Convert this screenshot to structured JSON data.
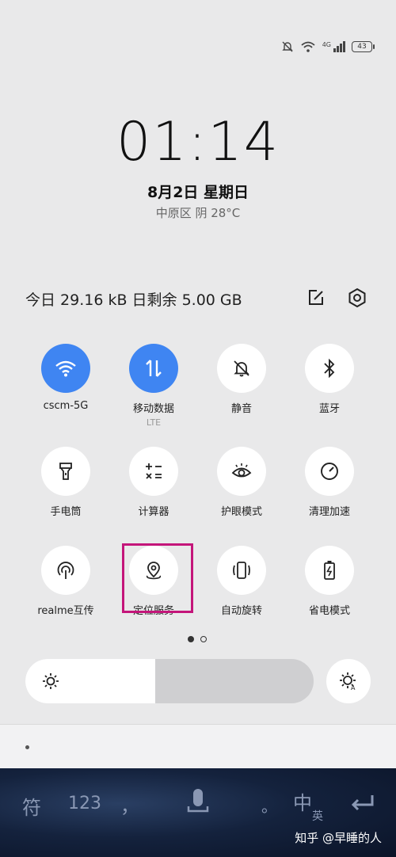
{
  "status_bar": {
    "icons": [
      "mute-bell-icon",
      "wifi-icon",
      "signal-4g-icon",
      "battery-icon"
    ],
    "network_label": "4G",
    "battery_level": "43"
  },
  "lockscreen": {
    "time": "01:14",
    "date": "8月2日  星期日",
    "weather": "中原区 阴 28°C"
  },
  "header": {
    "data_usage": "今日 29.16 kB  日剩余 5.00 GB",
    "edit_icon": "edit-icon",
    "settings_icon": "settings-icon"
  },
  "tiles": [
    {
      "label": "cscm-5G",
      "icon": "wifi-icon",
      "active": true
    },
    {
      "label": "移动数据",
      "sub": "LTE",
      "icon": "mobile-data-icon",
      "active": true
    },
    {
      "label": "静音",
      "icon": "mute-icon",
      "active": false
    },
    {
      "label": "蓝牙",
      "icon": "bluetooth-icon",
      "active": false
    },
    {
      "label": "手电筒",
      "icon": "flashlight-icon",
      "active": false
    },
    {
      "label": "计算器",
      "icon": "calculator-icon",
      "active": false
    },
    {
      "label": "护眼模式",
      "icon": "eye-icon",
      "active": false
    },
    {
      "label": "清理加速",
      "icon": "speedometer-icon",
      "active": false
    },
    {
      "label": "realme互传",
      "icon": "share-icon",
      "active": false
    },
    {
      "label": "定位服务",
      "icon": "location-icon",
      "active": false
    },
    {
      "label": "自动旋转",
      "icon": "rotate-icon",
      "active": false
    },
    {
      "label": "省电模式",
      "icon": "battery-saver-icon",
      "active": false
    }
  ],
  "pager": {
    "current": 1,
    "total": 2
  },
  "brightness": {
    "level": 0.45
  },
  "keyboard": {
    "keys": [
      "符",
      "123",
      "，",
      "。",
      "中",
      "英"
    ],
    "watermark": "知乎 @早睡的人"
  }
}
